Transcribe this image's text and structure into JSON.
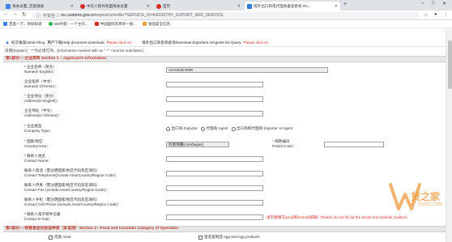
{
  "tabs": [
    {
      "title": "海关总署_百度搜索",
      "favicon_color": "#3b82f6",
      "active": false
    },
    {
      "title": "中华人民共和国海关总署",
      "favicon_color": "#d62d20",
      "active": false
    },
    {
      "title": "首页",
      "favicon_color": "#d62d20",
      "active": false
    },
    {
      "title": "境外出口商或代理商备案系统 Re...",
      "favicon_color": "#2f7bd5",
      "active": true
    }
  ],
  "address": {
    "secure_label": "不安全",
    "host": "ire.customs.gov.cn",
    "path": "/expire/controller?SERVICE_ID=REGISTRY_EXPORT_ADD_SERVICE"
  },
  "bookmarks": [
    {
      "label": "百度一下，你就知道",
      "color": "#3b82f6"
    },
    {
      "label": "360导航 - 一个主页...",
      "color": "#2bb34a"
    },
    {
      "label": "中国国际贸易单一窗...",
      "color": "#d62d20"
    },
    {
      "label": "食品安全信息",
      "color": "#e7a23b"
    }
  ],
  "notice": {
    "initial_filing": "初次备案Initial Filing",
    "help_text": "用户下载Help document download",
    "help_link": "Please click on",
    "query_text": "境外出口商名单查询Overseas Exporters orAgents list Query",
    "query_link": "Please click on"
  },
  "explain": "说明(Explain)：“*”为必填写项。(Information marked with an “ * ” must be submitted.)",
  "section1": "第1部分----企业资料 Section 1 -- Applicant's Information",
  "fields": {
    "name_en_cn": "* 企业名称（英文）",
    "name_en": "Name(in English)：",
    "name_en_value": "AHAZGB RRR",
    "name_cn_cn": "企业名称（中文）",
    "name_cn": "Name(in Chinese)：",
    "addr_en_cn": "* 企业地址（英文）",
    "addr_en": "Address(in English)：",
    "addr_cn_cn": "企业地址（中文）",
    "addr_cn": "Address(in Chinese)：",
    "type_cn": "* 企业类型",
    "type_en": "Company Type：",
    "type_options": [
      "出口商 Exporter",
      "代理商 Agent",
      "出口商和代理商 Exporter or Agent"
    ],
    "country_cn": "* 国家/地区",
    "country_en": "Country/Area：",
    "country_value": "阿塞拜疆(Azerbaijan)",
    "postcode_cn": "* 邮政编码",
    "postcode_en": "Postal Code：",
    "contact_cn": "* 联系人姓名",
    "contact_en": "Contact Name：",
    "tel_cn": "联系人电话（需注明国家/地区代码及区域码）",
    "tel_en": "Contact Telephone(Include Area/Country/Region Code)：",
    "fax_cn": "联系人传真（需注明国家/地区代码及区域码）",
    "fax_en": "Contact Fax (Include Area/Country/Region Code)：",
    "cell_cn": "联系人手机（需注明国家/地区代码及区域码）",
    "cell_en": "Contact Cell Phone (Include Area/Country/Region Code)：",
    "email_cn": "* 联系人电子邮件信箱",
    "email_en": "Contact E-mail：",
    "email_warning": "请不要填写gmail和hotmail邮箱！Please do not fill out the Gmail and Hotmail mailbox!"
  },
  "section2": "第2部分----经营食品化妆品种类（多选项）Section 2---Food and Cosmetic Category of Operation",
  "categories": [
    "肉类 meat",
    "蛋及蛋制品 egg and egg products"
  ],
  "watermark": {
    "text": "货之家",
    "sub": "51W2C.COM"
  }
}
